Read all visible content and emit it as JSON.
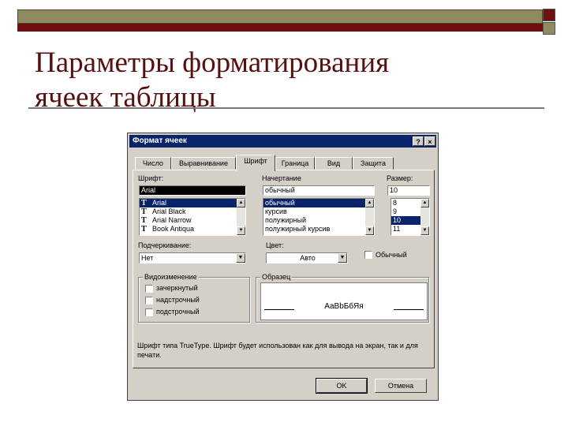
{
  "slide": {
    "title_line1": "Параметры форматирования",
    "title_line2": "ячеек таблицы"
  },
  "dialog": {
    "title": "Формат ячеек",
    "help_label": "?",
    "close_label": "×",
    "tabs": [
      {
        "label": "Число"
      },
      {
        "label": "Выравнивание"
      },
      {
        "label": "Шрифт"
      },
      {
        "label": "Граница"
      },
      {
        "label": "Вид"
      },
      {
        "label": "Защита"
      }
    ],
    "active_tab": "Шрифт",
    "font": {
      "label": "Шрифт:",
      "value": "Arial",
      "items": [
        "Arial",
        "Arial Black",
        "Arial Narrow",
        "Book Antiqua"
      ],
      "selected": "Arial",
      "tt_glyph": "T"
    },
    "style": {
      "label": "Начертание",
      "value": "обычный",
      "items": [
        "обычный",
        "курсив",
        "полужирный",
        "полужирный курсив"
      ],
      "selected": "обычный"
    },
    "size": {
      "label": "Размер:",
      "value": "10",
      "items": [
        "8",
        "9",
        "10",
        "11"
      ],
      "selected": "10"
    },
    "underline": {
      "label": "Подчеркивание:",
      "value": "Нет"
    },
    "color": {
      "label": "Цвет:",
      "value": "Авто"
    },
    "normal_checkbox_label": "Обычный",
    "effects": {
      "title": "Видоизменение",
      "items": [
        "зачеркнутый",
        "надстрочный",
        "подстрочный"
      ]
    },
    "sample": {
      "title": "Образец",
      "text": "AaBbБбЯя"
    },
    "info_text": "Шрифт типа TrueType. Шрифт будет использован как для вывода на экран, так и для печати.",
    "ok_label": "OK",
    "cancel_label": "Отмена"
  },
  "colors": {
    "title": "#5a0e0e",
    "caption_bar": "#0a246a",
    "dialog_face": "#d4d0c8",
    "accent_bar": "#6e1010",
    "olive_bar": "#8e8c5e"
  }
}
